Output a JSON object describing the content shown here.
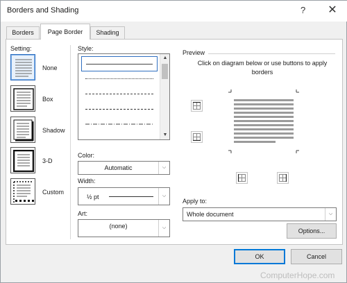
{
  "window": {
    "title": "Borders and Shading",
    "help_label": "?",
    "close_label": "✕"
  },
  "tabs": [
    {
      "label": "Borders",
      "active": false
    },
    {
      "label": "Page Border",
      "active": true
    },
    {
      "label": "Shading",
      "active": false
    }
  ],
  "setting": {
    "label": "Setting:",
    "options": [
      {
        "label": "None",
        "selected": true
      },
      {
        "label": "Box",
        "selected": false
      },
      {
        "label": "Shadow",
        "selected": false
      },
      {
        "label": "3-D",
        "selected": false
      },
      {
        "label": "Custom",
        "selected": false
      }
    ]
  },
  "style": {
    "label": "Style:",
    "items": [
      "solid",
      "dotted",
      "dash-small",
      "dashed",
      "dash-dot",
      "dash-dot-dot"
    ],
    "selected": 0
  },
  "color": {
    "label": "Color:",
    "value": "Automatic"
  },
  "width": {
    "label": "Width:",
    "value": "½ pt"
  },
  "art": {
    "label": "Art:",
    "value": "(none)"
  },
  "preview": {
    "label": "Preview",
    "instructions": "Click on diagram below or use buttons to apply borders"
  },
  "apply_to": {
    "label": "Apply to:",
    "value": "Whole document"
  },
  "buttons": {
    "options": "Options...",
    "ok": "OK",
    "cancel": "Cancel"
  },
  "watermark": "ComputerHope.com",
  "colors": {
    "accent": "#0078d7",
    "selection": "#2f6fc0",
    "dialog_bg": "#f0f0f0"
  }
}
